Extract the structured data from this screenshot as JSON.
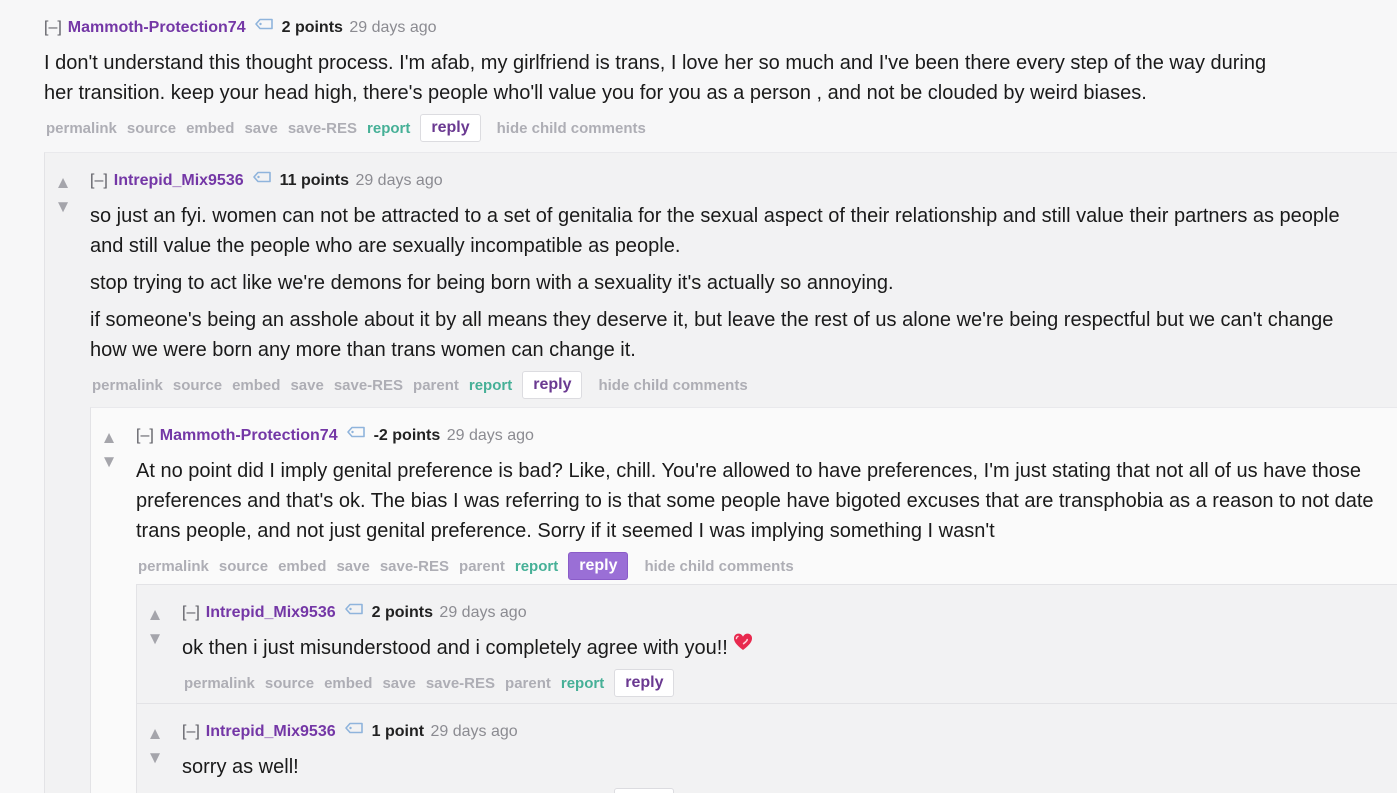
{
  "ui": {
    "upvote": "▲",
    "downvote": "▼",
    "collapse": "[–]",
    "actions": {
      "permalink": "permalink",
      "source": "source",
      "embed": "embed",
      "save": "save",
      "save_res": "save-RES",
      "parent": "parent",
      "report": "report",
      "reply": "reply",
      "hide_child": "hide child comments"
    },
    "colors": {
      "author": "#7437a6",
      "report": "#46b097",
      "reply_active": "#9a6fd6"
    },
    "icons": [
      "upvote-arrow-icon",
      "downvote-arrow-icon",
      "user-tag-icon",
      "heart-emoji-icon"
    ]
  },
  "comments": [
    {
      "author": "Mammoth-Protection74",
      "score": "2 points",
      "time": "29 days ago",
      "paragraphs": [
        "I don't understand this thought process. I'm afab, my girlfriend is trans, I love her so much and I've been there every step of the way during her transition. keep your head high, there's people who'll value you for you as a person , and not be clouded by weird biases."
      ]
    },
    {
      "author": "Intrepid_Mix9536",
      "score": "11 points",
      "time": "29 days ago",
      "paragraphs": [
        "so just an fyi. women can not be attracted to a set of genitalia for the sexual aspect of their relationship and still value their partners as people and still value the people who are sexually incompatible as people.",
        "stop trying to act like we're demons for being born with a sexuality it's actually so annoying.",
        "if someone's being an asshole about it by all means they deserve it, but leave the rest of us alone we're being respectful but we can't change how we were born any more than trans women can change it."
      ]
    },
    {
      "author": "Mammoth-Protection74",
      "score": "-2 points",
      "time": "29 days ago",
      "paragraphs": [
        "At no point did I imply genital preference is bad? Like, chill. You're allowed to have preferences, I'm just stating that not all of us have those preferences and that's ok. The bias I was referring to is that some people have bigoted excuses that are transphobia as a reason to not date trans people, and not just genital preference. Sorry if it seemed I was implying something I wasn't"
      ]
    },
    {
      "author": "Intrepid_Mix9536",
      "score": "2 points",
      "time": "29 days ago",
      "paragraphs": [
        "ok then i just misunderstood and i completely agree with you!!"
      ]
    },
    {
      "author": "Intrepid_Mix9536",
      "score": "1 point",
      "time": "29 days ago",
      "paragraphs": [
        "sorry as well!"
      ]
    }
  ]
}
